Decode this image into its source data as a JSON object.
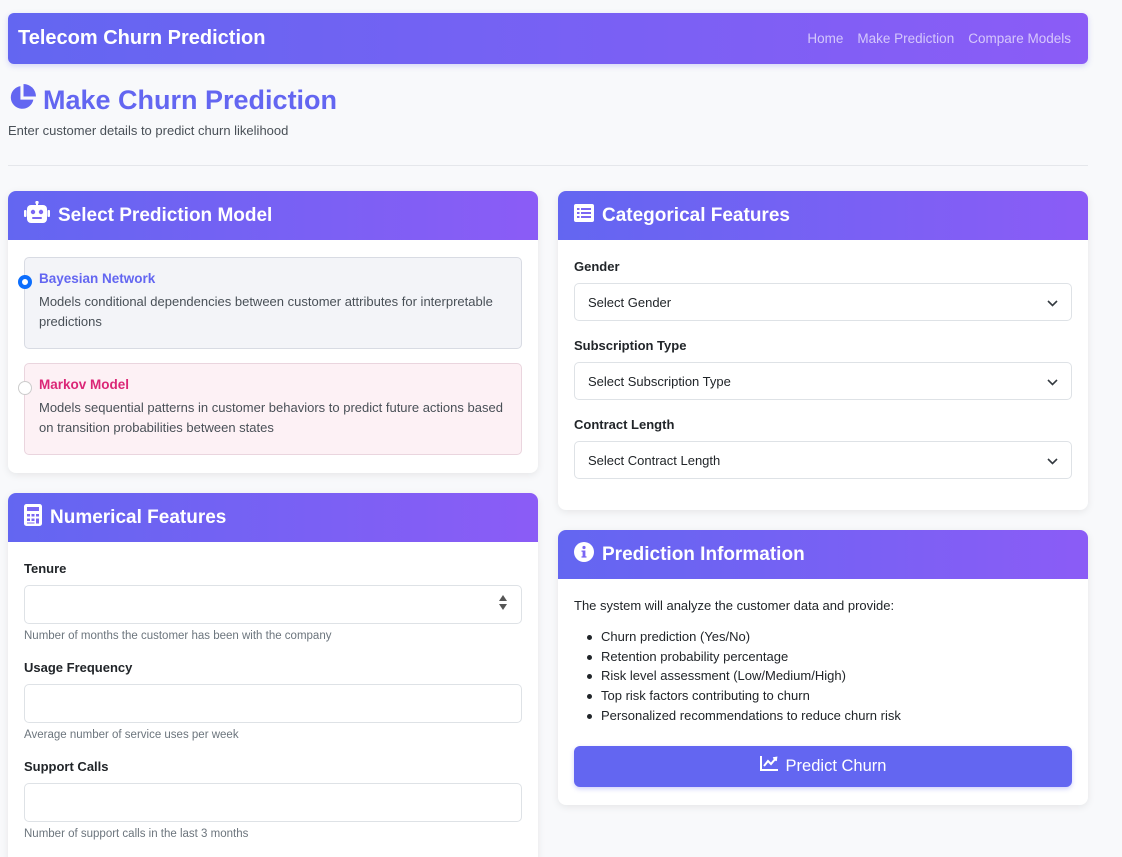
{
  "navbar": {
    "brand": "Telecom Churn Prediction",
    "links": [
      "Home",
      "Make Prediction",
      "Compare Models"
    ]
  },
  "page": {
    "title": "Make Churn Prediction",
    "subtitle": "Enter customer details to predict churn likelihood",
    "title_icon": "pie-chart-icon"
  },
  "model_card": {
    "title": "Select Prediction Model",
    "icon": "robot-icon",
    "options": [
      {
        "name": "Bayesian Network",
        "description": "Models conditional dependencies between customer attributes for interpretable predictions",
        "selected": true,
        "color": "#6366f1"
      },
      {
        "name": "Markov Model",
        "description": "Models sequential patterns in customer behaviors to predict future actions based on transition probabilities between states",
        "selected": false,
        "color": "#db2777"
      }
    ]
  },
  "numerical_card": {
    "title": "Numerical Features",
    "icon": "calculator-icon",
    "fields": [
      {
        "label": "Tenure",
        "value": "",
        "help": "Number of months the customer has been with the company"
      },
      {
        "label": "Usage Frequency",
        "value": "",
        "help": "Average number of service uses per week"
      },
      {
        "label": "Support Calls",
        "value": "",
        "help": "Number of support calls in the last 3 months"
      }
    ]
  },
  "categorical_card": {
    "title": "Categorical Features",
    "icon": "list-icon",
    "fields": [
      {
        "label": "Gender",
        "selected": "Select Gender"
      },
      {
        "label": "Subscription Type",
        "selected": "Select Subscription Type"
      },
      {
        "label": "Contract Length",
        "selected": "Select Contract Length"
      }
    ]
  },
  "info_card": {
    "title": "Prediction Information",
    "icon": "info-icon",
    "intro": "The system will analyze the customer data and provide:",
    "items": [
      "Churn prediction (Yes/No)",
      "Retention probability percentage",
      "Risk level assessment (Low/Medium/High)",
      "Top risk factors contributing to churn",
      "Personalized recommendations to reduce churn risk"
    ],
    "button_label": "Predict Churn",
    "button_icon": "chart-line-icon"
  },
  "colors": {
    "primary": "#6366f1",
    "gradient_end": "#8b5cf6",
    "radio_checked": "#0d6efd"
  }
}
